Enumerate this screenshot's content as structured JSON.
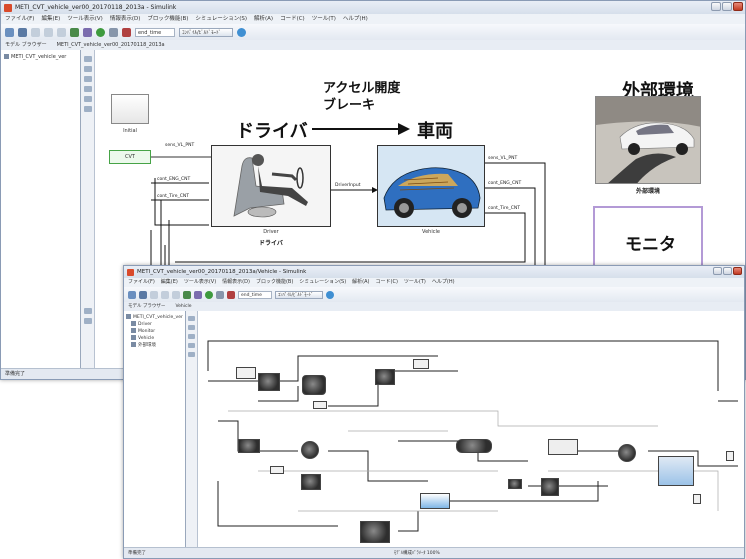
{
  "main_window": {
    "title": "METI_CVT_vehicle_ver00_20170118_2013a - Simulink",
    "menu": [
      "ファイル(F)",
      "編集(E)",
      "ツール表示(V)",
      "情報表示(D)",
      "ブロック機能(B)",
      "シミュレーション(S)",
      "解析(A)",
      "コード(C)",
      "ツール(T)",
      "ヘルプ(H)"
    ],
    "toolbar": {
      "stop_time": "end_time",
      "mode_button": "ｺﾝﾊﾟｲﾙ/ﾋﾞﾙﾄﾞﾓｰﾄﾞ"
    },
    "tab": "METI_CVT_vehicle_ver00_20170118_2013a",
    "model_browser_label": "モデル ブラウザー",
    "tree_root": "METI_CVT_vehicle_ver",
    "status": "準備完了"
  },
  "diagram": {
    "accel_label": "アクセル開度",
    "brake_label": "ブレーキ",
    "driver_big": "ドライバ",
    "vehicle_big": "車両",
    "env_big": "外部環境",
    "env_caption": "外部環境",
    "monitor_big": "モニタ",
    "driver_block_caption": "Driver",
    "driver_sub_caption": "ドライバ",
    "vehicle_block_caption": "Vehicle",
    "init_block_caption": "Initial",
    "green_block_label": "CVT",
    "signals": {
      "s1": "sens_VL_PNT",
      "s2": "cont_ENG_CNT",
      "s3": "cont_Tire_CNT",
      "s4": "DriverInput",
      "s5": "sens_VL_PNT",
      "s6": "cont_ENG_CNT",
      "s7": "cont_Tire_CNT"
    }
  },
  "overlay_window": {
    "title": "METI_CVT_vehicle_ver00_20170118_2013a/Vehicle - Simulink",
    "menu": [
      "ファイル(F)",
      "編集(E)",
      "ツール表示(V)",
      "情報表示(D)",
      "ブロック機能(B)",
      "シミュレーション(S)",
      "解析(A)",
      "コード(C)",
      "ツール(T)",
      "ヘルプ(H)"
    ],
    "toolbar": {
      "stop_time": "end_time",
      "mode_button": "ｺﾝﾊﾟｲﾙ/ﾋﾞﾙﾄﾞﾓｰﾄﾞ"
    },
    "tab": "Vehicle",
    "model_browser_label": "モデル ブラウザー",
    "tree": [
      "METI_CVT_vehicle_ver",
      "Driver",
      "Monitor",
      "Vehicle",
      "外部環境"
    ],
    "status_left": "準備完了",
    "status_mid": "ﾓﾃﾞﾙ構成ﾊﾟﾗﾒｰﾀ 100%"
  },
  "colors": {
    "title_icon": "#d94a2b",
    "green_block": "#6cc96c",
    "monitor_border": "#b39ad6",
    "close_button": "#c23a22"
  }
}
